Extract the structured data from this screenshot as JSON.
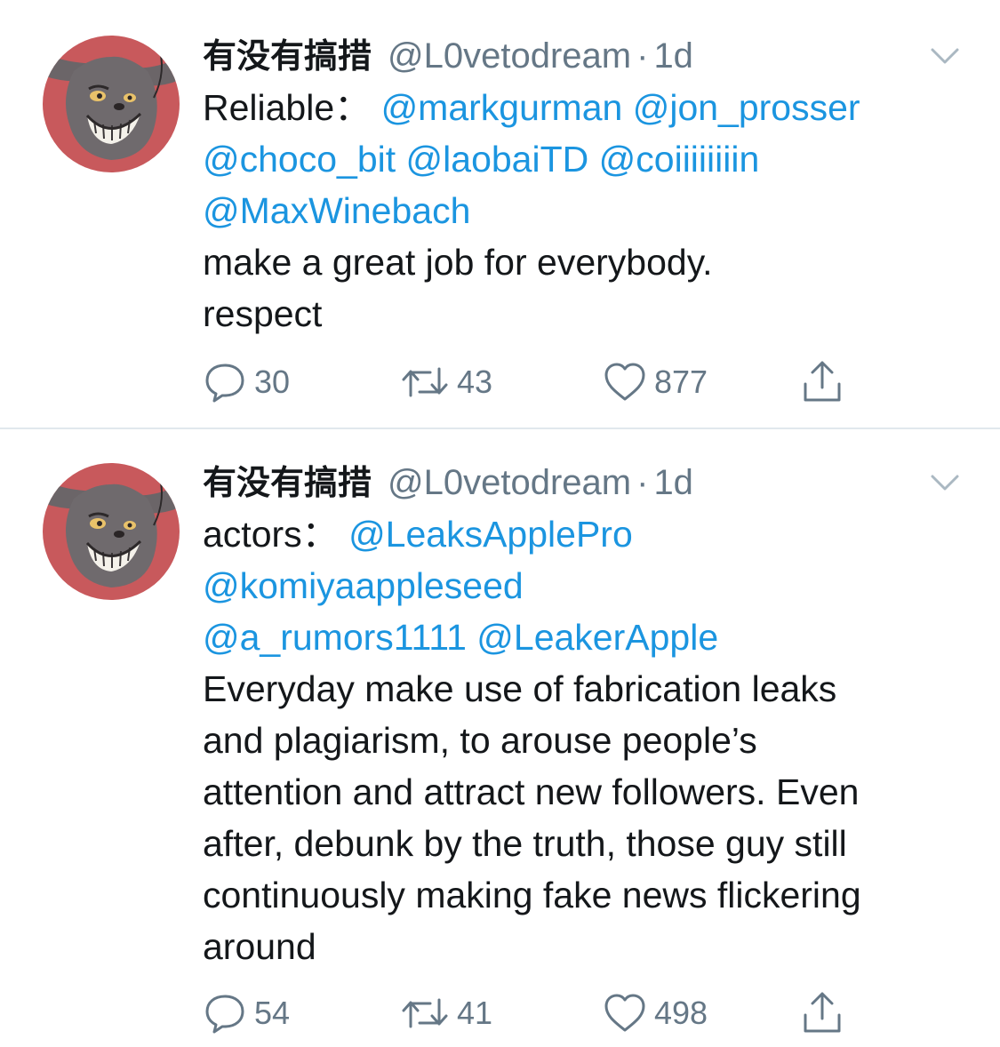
{
  "colors": {
    "link": "#1b95e0",
    "text": "#14171a",
    "secondary": "#657786",
    "divider": "#e1e8ed"
  },
  "tweets": [
    {
      "author": {
        "display_name": "有没有搞措",
        "handle": "@L0vetodream",
        "separator": "·",
        "time": "1d",
        "avatar_icon": "cartoon-cat-avatar"
      },
      "body": {
        "intro": "Reliable：",
        "mentions": [
          "@markgurman",
          "@jon_prosser",
          "@choco_bit",
          "@laobaiTD",
          "@coiiiiiiiin",
          "@MaxWinebach"
        ],
        "lines": [
          "make a great job for everybody.",
          "respect"
        ]
      },
      "actions": {
        "reply_count": "30",
        "retweet_count": "43",
        "like_count": "877",
        "icons": [
          "reply-icon",
          "retweet-icon",
          "like-icon",
          "share-icon"
        ]
      }
    },
    {
      "author": {
        "display_name": "有没有搞措",
        "handle": "@L0vetodream",
        "separator": "·",
        "time": "1d",
        "avatar_icon": "cartoon-cat-avatar"
      },
      "body": {
        "intro": "actors：",
        "mentions": [
          "@LeaksApplePro",
          "@komiyaappleseed",
          "@a_rumors1111",
          "@LeakerApple"
        ],
        "lines": [
          "Everyday make use of fabrication leaks",
          "and plagiarism, to arouse people’s",
          "attention and attract new followers. Even",
          "after, debunk by the truth, those guy still",
          "continuously making fake news flickering",
          "around"
        ]
      },
      "actions": {
        "reply_count": "54",
        "retweet_count": "41",
        "like_count": "498",
        "icons": [
          "reply-icon",
          "retweet-icon",
          "like-icon",
          "share-icon"
        ]
      }
    }
  ]
}
